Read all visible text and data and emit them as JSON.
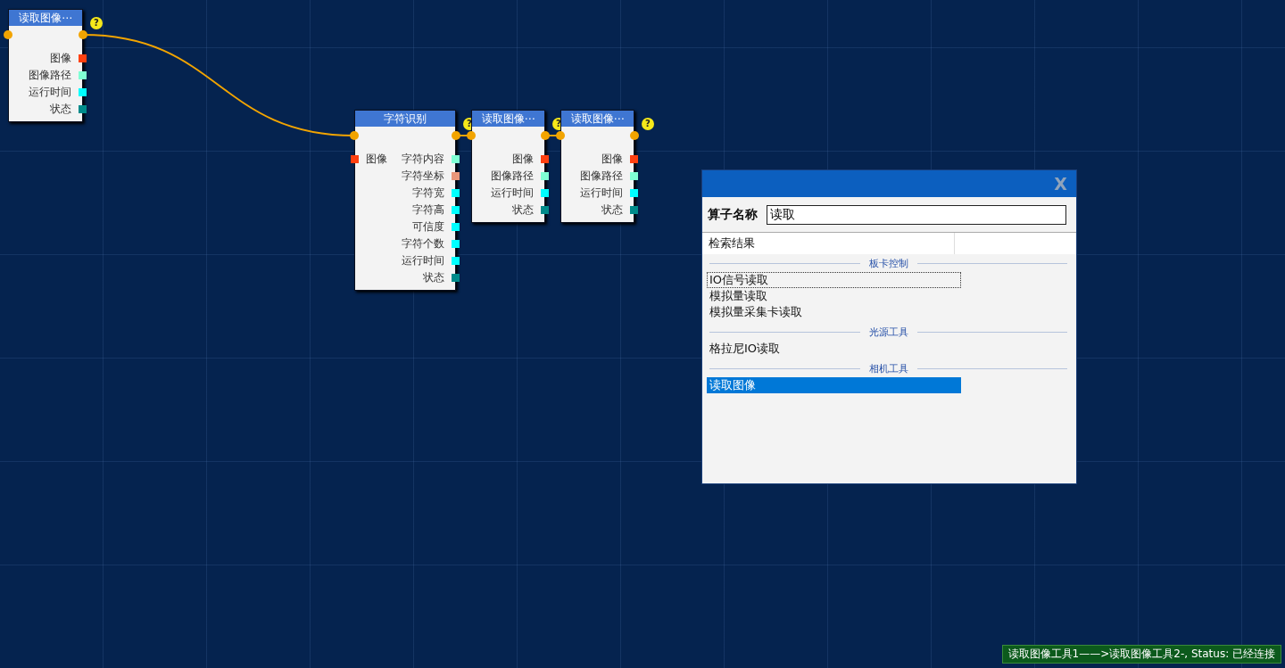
{
  "nodes": [
    {
      "title": "读取图像⋯",
      "help": "?",
      "outputs": [
        {
          "label": "图像",
          "color": "#ff4010"
        },
        {
          "label": "图像路径",
          "color": "#7fffd4"
        },
        {
          "label": "运行时间",
          "color": "#00ffff"
        },
        {
          "label": "状态",
          "color": "#008b8b"
        }
      ]
    },
    {
      "title": "字符识别",
      "help": "?",
      "inputs": [
        {
          "label": "图像",
          "color": "#ff4010"
        }
      ],
      "outputs": [
        {
          "label": "字符内容",
          "color": "#7fffd4"
        },
        {
          "label": "字符坐标",
          "color": "#e9967a"
        },
        {
          "label": "字符宽",
          "color": "#00ffff"
        },
        {
          "label": "字符高",
          "color": "#00ffff"
        },
        {
          "label": "可信度",
          "color": "#00ffff"
        },
        {
          "label": "字符个数",
          "color": "#00ffff"
        },
        {
          "label": "运行时间",
          "color": "#00ffff"
        },
        {
          "label": "状态",
          "color": "#008b8b"
        }
      ]
    },
    {
      "title": "读取图像⋯",
      "help": "?",
      "outputs": [
        {
          "label": "图像",
          "color": "#ff4010"
        },
        {
          "label": "图像路径",
          "color": "#7fffd4"
        },
        {
          "label": "运行时间",
          "color": "#00ffff"
        },
        {
          "label": "状态",
          "color": "#008b8b"
        }
      ]
    },
    {
      "title": "读取图像⋯",
      "help": "?",
      "outputs": [
        {
          "label": "图像",
          "color": "#ff4010"
        },
        {
          "label": "图像路径",
          "color": "#7fffd4"
        },
        {
          "label": "运行时间",
          "color": "#00ffff"
        },
        {
          "label": "状态",
          "color": "#008b8b"
        }
      ]
    }
  ],
  "dialog": {
    "close": "X",
    "name_label": "算子名称",
    "search": {
      "value": "读取"
    },
    "results_header": "检索结果",
    "groups": [
      {
        "title": "板卡控制",
        "items": [
          {
            "label": "IO信号读取",
            "selected": false,
            "focused": true
          },
          {
            "label": "模拟量读取",
            "selected": false,
            "focused": false
          },
          {
            "label": "模拟量采集卡读取",
            "selected": false,
            "focused": false
          }
        ]
      },
      {
        "title": "光源工具",
        "items": [
          {
            "label": "格拉尼IO读取",
            "selected": false,
            "focused": false
          }
        ]
      },
      {
        "title": "相机工具",
        "items": [
          {
            "label": "读取图像",
            "selected": true,
            "focused": false
          }
        ]
      }
    ]
  },
  "status_bar": "读取图像工具1——>读取图像工具2-, Status: 已经连接"
}
